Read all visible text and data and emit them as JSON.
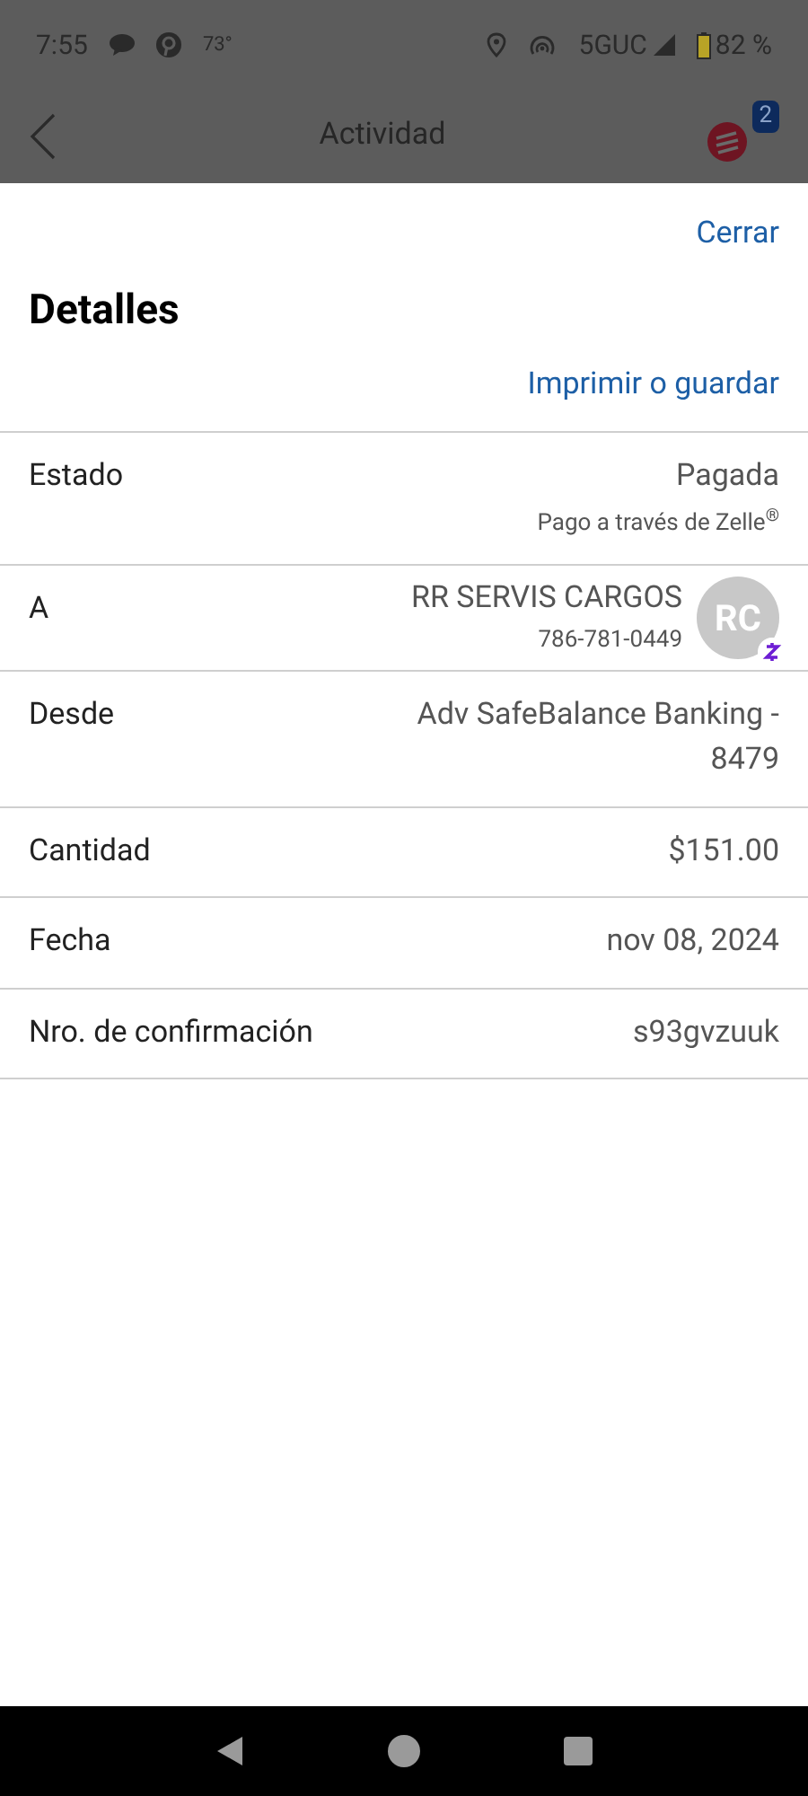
{
  "status_bar": {
    "time": "7:55",
    "temperature": "73°",
    "network": "5GUC",
    "battery": "82 %"
  },
  "app_bar": {
    "title": "Actividad",
    "badge": "2"
  },
  "sheet": {
    "close": "Cerrar",
    "title": "Detalles",
    "print": "Imprimir o guardar"
  },
  "rows": [
    {
      "kind": "status",
      "label": "Estado",
      "value": "Pagada",
      "note": "Pago a través de Zelle$^{®}$"
    },
    {
      "kind": "payee",
      "label": "A",
      "value": "RR SERVIS CARGOS",
      "note": "786-781-0449",
      "initials": "RC"
    },
    {
      "kind": "plain",
      "label": "Desde",
      "value": "Adv SafeBalance Banking - 8479"
    },
    {
      "kind": "plain",
      "label": "Cantidad",
      "value": "$151.00"
    },
    {
      "kind": "plain",
      "label": "Fecha",
      "value": "nov 08, 2024"
    },
    {
      "kind": "plain",
      "label": "Nro. de confirmación",
      "value": "s93gvzuuk"
    }
  ]
}
